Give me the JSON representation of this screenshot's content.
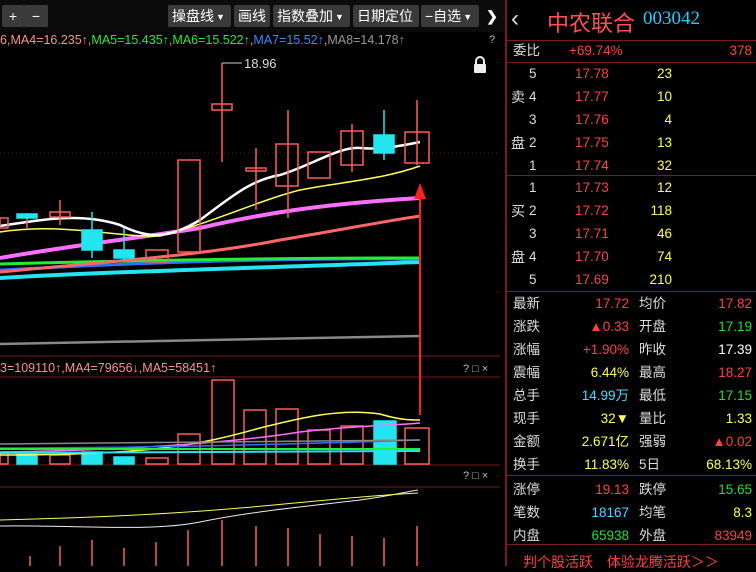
{
  "toolbar": {
    "plus": "+",
    "minus": "−",
    "buttons": [
      "操盘线",
      "画线",
      "指数叠加",
      "日期定位",
      "−自选"
    ],
    "more": "❯"
  },
  "ma_line": {
    "ma3_tail": "6",
    "ma4": "MA4=16.235↑",
    "ma5": "MA5=15.435↑",
    "ma6": "MA6=15.522↑",
    "ma7": "MA7=15.52↑",
    "ma8": "MA8=14.178↑",
    "help": "?"
  },
  "price_annotation": "18.96",
  "vol_line": {
    "ma3": "3=109110↑",
    "ma4": "MA4=79656↓",
    "ma5": "MA5=58451↑",
    "controls": "? □ ×"
  },
  "sub_controls": "? □ ×",
  "stock": {
    "name": "中农联合",
    "code": "003042",
    "back": "‹"
  },
  "weibi": {
    "label": "委比",
    "value": "+69.74%",
    "diff": "378"
  },
  "sell": {
    "side_label": [
      "卖",
      "盘"
    ],
    "rows": [
      {
        "lvl": "5",
        "price": "17.78",
        "vol": "23"
      },
      {
        "lvl": "4",
        "price": "17.77",
        "vol": "10"
      },
      {
        "lvl": "3",
        "price": "17.76",
        "vol": "4"
      },
      {
        "lvl": "2",
        "price": "17.75",
        "vol": "13"
      },
      {
        "lvl": "1",
        "price": "17.74",
        "vol": "32"
      }
    ]
  },
  "buy": {
    "side_label": [
      "买",
      "盘"
    ],
    "rows": [
      {
        "lvl": "1",
        "price": "17.73",
        "vol": "12"
      },
      {
        "lvl": "2",
        "price": "17.72",
        "vol": "118"
      },
      {
        "lvl": "3",
        "price": "17.71",
        "vol": "46"
      },
      {
        "lvl": "4",
        "price": "17.70",
        "vol": "74"
      },
      {
        "lvl": "5",
        "price": "17.69",
        "vol": "210"
      }
    ]
  },
  "quote": [
    {
      "l1": "最新",
      "v1": "17.72",
      "c1": "red",
      "l2": "均价",
      "v2": "17.82",
      "c2": "red"
    },
    {
      "l1": "涨跌",
      "v1": "▲0.33",
      "c1": "red",
      "l2": "开盘",
      "v2": "17.19",
      "c2": "green"
    },
    {
      "l1": "涨幅",
      "v1": "+1.90%",
      "c1": "red",
      "l2": "昨收",
      "v2": "17.39",
      "c2": "white"
    },
    {
      "l1": "震幅",
      "v1": "6.44%",
      "c1": "yellow",
      "l2": "最高",
      "v2": "18.27",
      "c2": "red"
    },
    {
      "l1": "总手",
      "v1": "14.99万",
      "c1": "cyan",
      "l2": "最低",
      "v2": "17.15",
      "c2": "green"
    },
    {
      "l1": "现手",
      "v1": "32▼",
      "c1": "yellow",
      "l2": "量比",
      "v2": "1.33",
      "c2": "yellow"
    },
    {
      "l1": "金额",
      "v1": "2.671亿",
      "c1": "yellow",
      "l2": "强弱",
      "v2": "▲0.02",
      "c2": "red"
    },
    {
      "l1": "换手",
      "v1": "11.83%",
      "c1": "yellow",
      "l2": "5日",
      "v2": "68.13%",
      "c2": "yellow"
    },
    {
      "l1": "涨停",
      "v1": "19.13",
      "c1": "red",
      "l2": "跌停",
      "v2": "15.65",
      "c2": "green"
    },
    {
      "l1": "笔数",
      "v1": "18167",
      "c1": "cyan",
      "l2": "均笔",
      "v2": "8.3",
      "c2": "yellow"
    },
    {
      "l1": "内盘",
      "v1": "65938",
      "c1": "green",
      "l2": "外盘",
      "v2": "83949",
      "c2": "red"
    }
  ],
  "footer": {
    "link1": "判个股活跃",
    "link2": "体验龙腾活跃＞＞"
  },
  "colors": {
    "up": "#ff5a5a",
    "down": "#22e5f0",
    "border": "#7a1a1a"
  }
}
